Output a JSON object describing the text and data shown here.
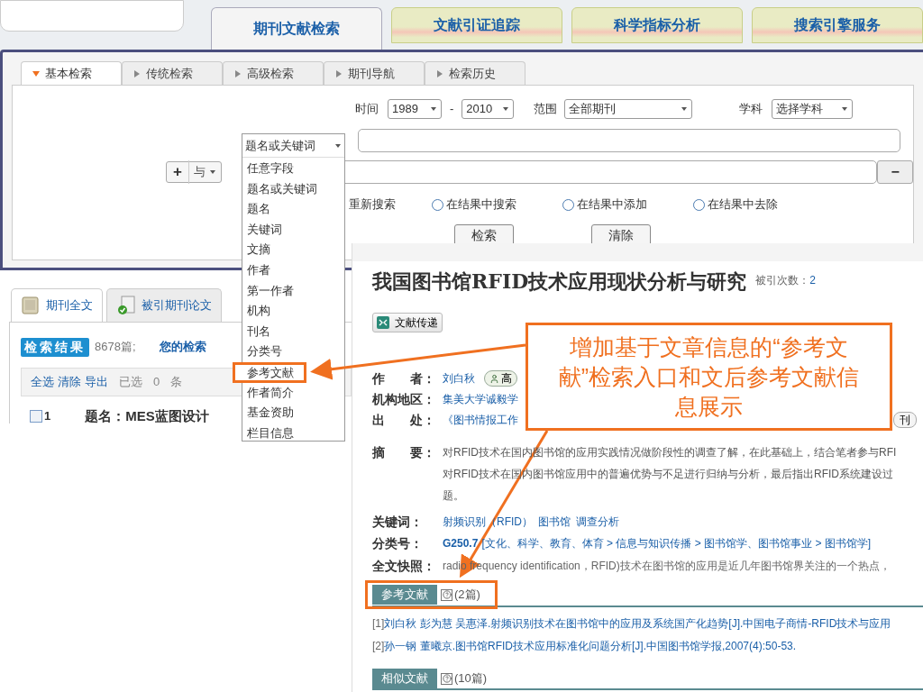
{
  "top_tabs": [
    {
      "label": "期刊文献检索",
      "selected": true
    },
    {
      "label": "文献引证追踪",
      "selected": false
    },
    {
      "label": "科学指标分析",
      "selected": false
    },
    {
      "label": "搜索引擎服务",
      "selected": false
    }
  ],
  "search_tabs": [
    {
      "label": "基本检索",
      "selected": true
    },
    {
      "label": "传统检索",
      "selected": false
    },
    {
      "label": "高级检索",
      "selected": false
    },
    {
      "label": "期刊导航",
      "selected": false
    },
    {
      "label": "检索历史",
      "selected": false
    }
  ],
  "filters": {
    "time_label": "时间",
    "from": "1989",
    "dash": "-",
    "to": "2010",
    "range_label": "范围",
    "range": "全部期刊",
    "subject_label": "学科",
    "subject": "选择学科"
  },
  "logic": {
    "plus": "+",
    "op": "与",
    "minus": "−"
  },
  "field_dropdown": {
    "value": "题名或关键词",
    "options": [
      {
        "label": "任意字段",
        "framed": false
      },
      {
        "label": "题名或关键词",
        "framed": false
      },
      {
        "label": "题名",
        "framed": false
      },
      {
        "label": "关键词",
        "framed": false
      },
      {
        "label": "文摘",
        "framed": false
      },
      {
        "label": "作者",
        "framed": false
      },
      {
        "label": "第一作者",
        "framed": false
      },
      {
        "label": "机构",
        "framed": false
      },
      {
        "label": "刊名",
        "framed": false
      },
      {
        "label": "分类号",
        "framed": false
      },
      {
        "label": "参考文献",
        "framed": true
      },
      {
        "label": "作者简介",
        "framed": false
      },
      {
        "label": "基金资助",
        "framed": false
      },
      {
        "label": "栏目信息",
        "framed": false
      }
    ]
  },
  "new_search_label": "重新搜索",
  "radios": [
    {
      "label": "在结果中搜索",
      "selected": false
    },
    {
      "label": "在结果中添加",
      "selected": false
    },
    {
      "label": "在结果中去除",
      "selected": false
    }
  ],
  "action_buttons": [
    "检索",
    "清除"
  ],
  "result_tabs": [
    {
      "label": "期刊全文",
      "selected": true,
      "kind": "book"
    },
    {
      "label": "被引期刊论文",
      "selected": false,
      "kind": "doc"
    }
  ],
  "results": {
    "badge": "检索结果",
    "count": "8678篇;",
    "query_label": "您的检索",
    "toolbar_links": [
      "全选",
      "清除",
      "导出"
    ],
    "selected_label": "已选",
    "selected_count": "0",
    "unit": "条"
  },
  "result_rows": [
    {
      "checked": false,
      "number": "1",
      "title": "题名：MES蓝图设计"
    }
  ],
  "detail": {
    "title": "我国图书馆RFID技术应用现状分析与研究",
    "cited_label": "被引次数：",
    "cited_count": "2",
    "delivery_button": "文献传递",
    "fields": [
      {
        "kind": "author",
        "label": "作　　者：",
        "value": "刘白秋",
        "badge": "高"
      },
      {
        "kind": "link",
        "label": "机构地区：",
        "value": "集美大学诚毅学"
      },
      {
        "kind": "source",
        "label": "出　　处：",
        "value": "《图书情报工作",
        "tag": "刊"
      },
      {
        "kind": "abstract",
        "label": "摘　　要：",
        "lines": [
          "对RFID技术在国内图书馆的应用实践情况做阶段性的调查了解，在此基础上，结合笔者参与RFI",
          "对RFID技术在国内图书馆应用中的普遍优势与不足进行归纳与分析，最后指出RFID系统建设过",
          "题。"
        ]
      },
      {
        "kind": "keywords",
        "label": "关键词：",
        "values": [
          "射频识别（RFID）",
          "图书馆",
          "调查分析"
        ]
      },
      {
        "kind": "class",
        "label": "分类号：",
        "code": "G250.7",
        "path": "[文化、科学、教育、体育 > 信息与知识传播 > 图书馆学、图书馆事业 > 图书馆学]"
      },
      {
        "kind": "snapshot",
        "label": "全文快照：",
        "value": "radio frequency identification，RFID)技术在图书馆的应用是近几年图书馆界关注的一个热点，"
      }
    ],
    "sections": [
      {
        "title": "参考文献",
        "count": "(2篇)",
        "framed": true,
        "items": [
          {
            "index": "[1]",
            "text": "刘白秋 彭为慧 吴惠泽.射频识别技术在图书馆中的应用及系统国产化趋势[J].中国电子商情-RFID技术与应用"
          },
          {
            "index": "[2]",
            "text": "孙一钢 董曦京.图书馆RFID技术应用标准化问题分析[J].中国图书馆学报,2007(4):50-53."
          }
        ]
      },
      {
        "title": "相似文献",
        "count": "(10篇)",
        "framed": false
      }
    ]
  },
  "callout": {
    "text": "增加基于文章信息的“参考文献”检索入口和文后参考文献信息展示"
  }
}
